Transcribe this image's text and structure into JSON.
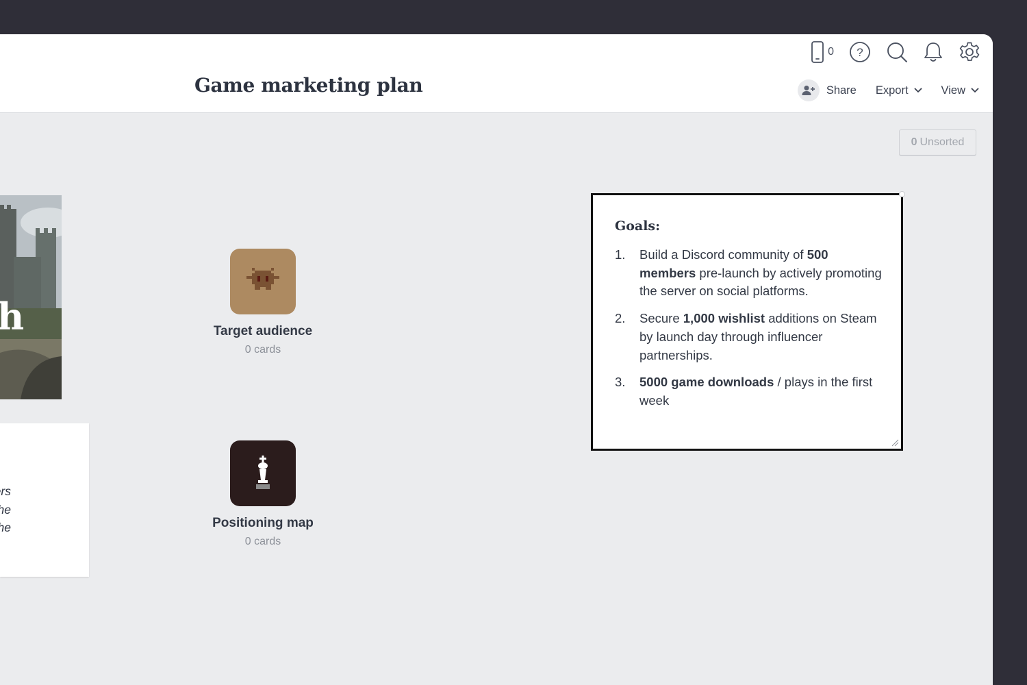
{
  "header": {
    "title": "Game marketing plan",
    "device_count": "0",
    "share_label": "Share",
    "export_label": "Export",
    "view_label": "View",
    "icons": [
      "mobile-device-icon",
      "help-icon",
      "search-icon",
      "bell-icon",
      "gear-icon"
    ]
  },
  "canvas": {
    "unsorted_count": "0",
    "unsorted_label": "Unsorted",
    "cover_letter": "h",
    "left_note": {
      "lines": [
        "e players",
        "back the",
        "scue the"
      ]
    },
    "boards": [
      {
        "name": "Target audience",
        "count": "0 cards",
        "tile_color": "#ad8a61",
        "icon": "pixel-monster-icon"
      },
      {
        "name": "Positioning map",
        "count": "0 cards",
        "tile_color": "#2b1c1c",
        "icon": "chess-king-icon"
      }
    ],
    "goals_card": {
      "title": "Goals:",
      "items": [
        {
          "num": "1.",
          "parts": [
            {
              "t": "Build a Discord community of "
            },
            {
              "t": "500 members",
              "b": true
            },
            {
              "t": " pre-launch by actively promoting the server on social platforms."
            }
          ]
        },
        {
          "num": "2.",
          "parts": [
            {
              "t": "Secure "
            },
            {
              "t": "1,000 wishlist",
              "b": true
            },
            {
              "t": " additions on Steam by launch day through influencer partnerships."
            }
          ]
        },
        {
          "num": "3.",
          "parts": [
            {
              "t": "5000 game downloads",
              "b": true
            },
            {
              "t": " / plays in the first week"
            }
          ]
        }
      ]
    }
  },
  "colors": {
    "window_frame": "#2f2e38",
    "canvas": "#ebecee",
    "header": "#ffffff",
    "text": "#2d3340"
  }
}
